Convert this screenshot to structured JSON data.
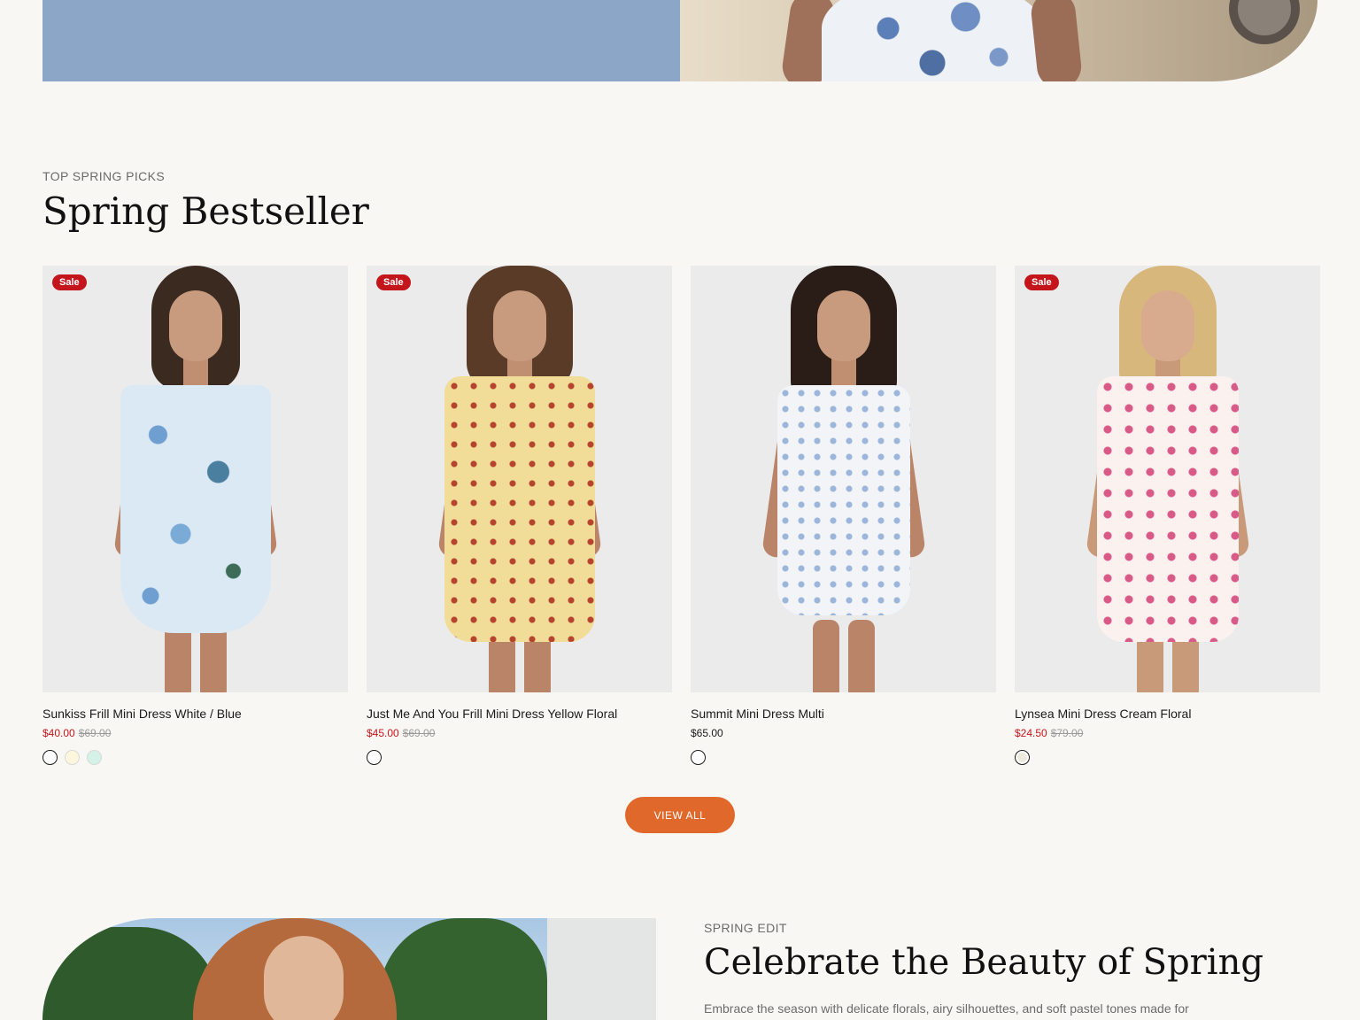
{
  "section": {
    "eyebrow": "TOP SPRING PICKS",
    "title": "Spring Bestseller"
  },
  "products": [
    {
      "name": "Sunkiss Frill Mini Dress White / Blue",
      "badge": "Sale",
      "price": "$40.00",
      "compare_price": "$69.00",
      "swatches": [
        "#ffffff",
        "#fbf6dc",
        "#d4f2e8"
      ]
    },
    {
      "name": "Just Me And You Frill Mini Dress Yellow Floral",
      "badge": "Sale",
      "price": "$45.00",
      "compare_price": "$69.00",
      "swatches": [
        "#ffffff"
      ]
    },
    {
      "name": "Summit Mini Dress Multi",
      "badge": "",
      "price": "$65.00",
      "compare_price": "",
      "swatches": [
        "#ffffff"
      ]
    },
    {
      "name": "Lynsea Mini Dress Cream Floral",
      "badge": "Sale",
      "price": "$24.50",
      "compare_price": "$79.00",
      "swatches": [
        "#eeeadb"
      ]
    }
  ],
  "view_all_label": "VIEW ALL",
  "edit": {
    "eyebrow": "SPRING EDIT",
    "title": "Celebrate the Beauty of Spring",
    "body": "Embrace the season with delicate florals, airy silhouettes, and soft pastel tones made for"
  },
  "colors": {
    "background": "#f9f7f3",
    "accent": "#e0682b",
    "sale": "#c4151c",
    "banner_blue": "#8ca6c7"
  }
}
